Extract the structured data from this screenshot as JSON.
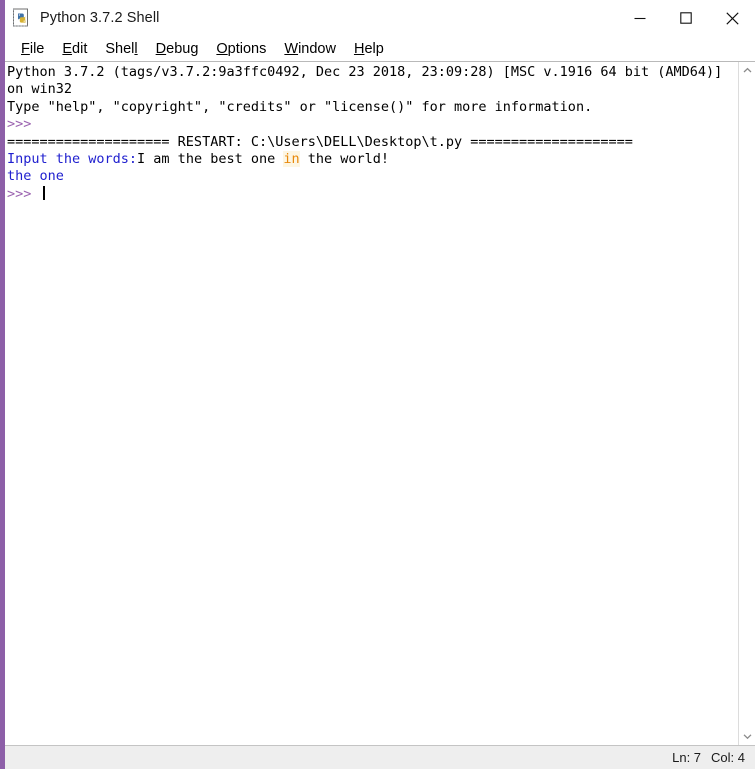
{
  "window": {
    "title": "Python 3.7.2 Shell",
    "icon": "python-idle-icon",
    "controls": [
      {
        "name": "minimize-button",
        "glyph": "minimize-icon"
      },
      {
        "name": "maximize-button",
        "glyph": "maximize-icon"
      },
      {
        "name": "close-button",
        "glyph": "close-icon"
      }
    ]
  },
  "menubar": {
    "items": [
      {
        "label": "File",
        "pre": "",
        "accel": "F",
        "post": "ile"
      },
      {
        "label": "Edit",
        "pre": "",
        "accel": "E",
        "post": "dit"
      },
      {
        "label": "Shell",
        "pre": "Shel",
        "accel": "l",
        "post": ""
      },
      {
        "label": "Debug",
        "pre": "",
        "accel": "D",
        "post": "ebug"
      },
      {
        "label": "Options",
        "pre": "",
        "accel": "O",
        "post": "ptions"
      },
      {
        "label": "Window",
        "pre": "",
        "accel": "W",
        "post": "indow"
      },
      {
        "label": "Help",
        "pre": "",
        "accel": "H",
        "post": "elp"
      }
    ]
  },
  "console": {
    "lines": [
      [
        {
          "text": "Python 3.7.2 (tags/v3.7.2:9a3ffc0492, Dec 23 2018, 23:09:28) [MSC v.1916 64 bit (AMD64)] on win32",
          "style": "plain"
        }
      ],
      [
        {
          "text": "Type \"help\", \"copyright\", \"credits\" or \"license()\" for more information.",
          "style": "plain"
        }
      ],
      [
        {
          "text": ">>> ",
          "style": "prompt"
        }
      ],
      [
        {
          "text": "==================== RESTART: C:\\Users\\DELL\\Desktop\\t.py ====================",
          "style": "plain"
        }
      ],
      [
        {
          "text": "Input the words:",
          "style": "stdout"
        },
        {
          "text": "I am the best one ",
          "style": "plain"
        },
        {
          "text": "in",
          "style": "keyword"
        },
        {
          "text": " the world!",
          "style": "plain"
        }
      ],
      [
        {
          "text": "the one",
          "style": "stdout"
        }
      ],
      [
        {
          "text": ">>> ",
          "style": "prompt"
        },
        {
          "text": "",
          "style": "caret"
        }
      ]
    ]
  },
  "scrollbar": {
    "up_arrow": "chevron-up-icon",
    "down_arrow": "chevron-down-icon"
  },
  "statusbar": {
    "line": "Ln: 7",
    "col": "Col: 4"
  },
  "colors": {
    "stdout": "#2020cf",
    "prompt": "#9b63b0",
    "keyword": "#e8890c",
    "keyword_bg": "#fdf6e3",
    "window_border": "#8d5fa8",
    "statusbar_bg": "#eeeeee"
  }
}
